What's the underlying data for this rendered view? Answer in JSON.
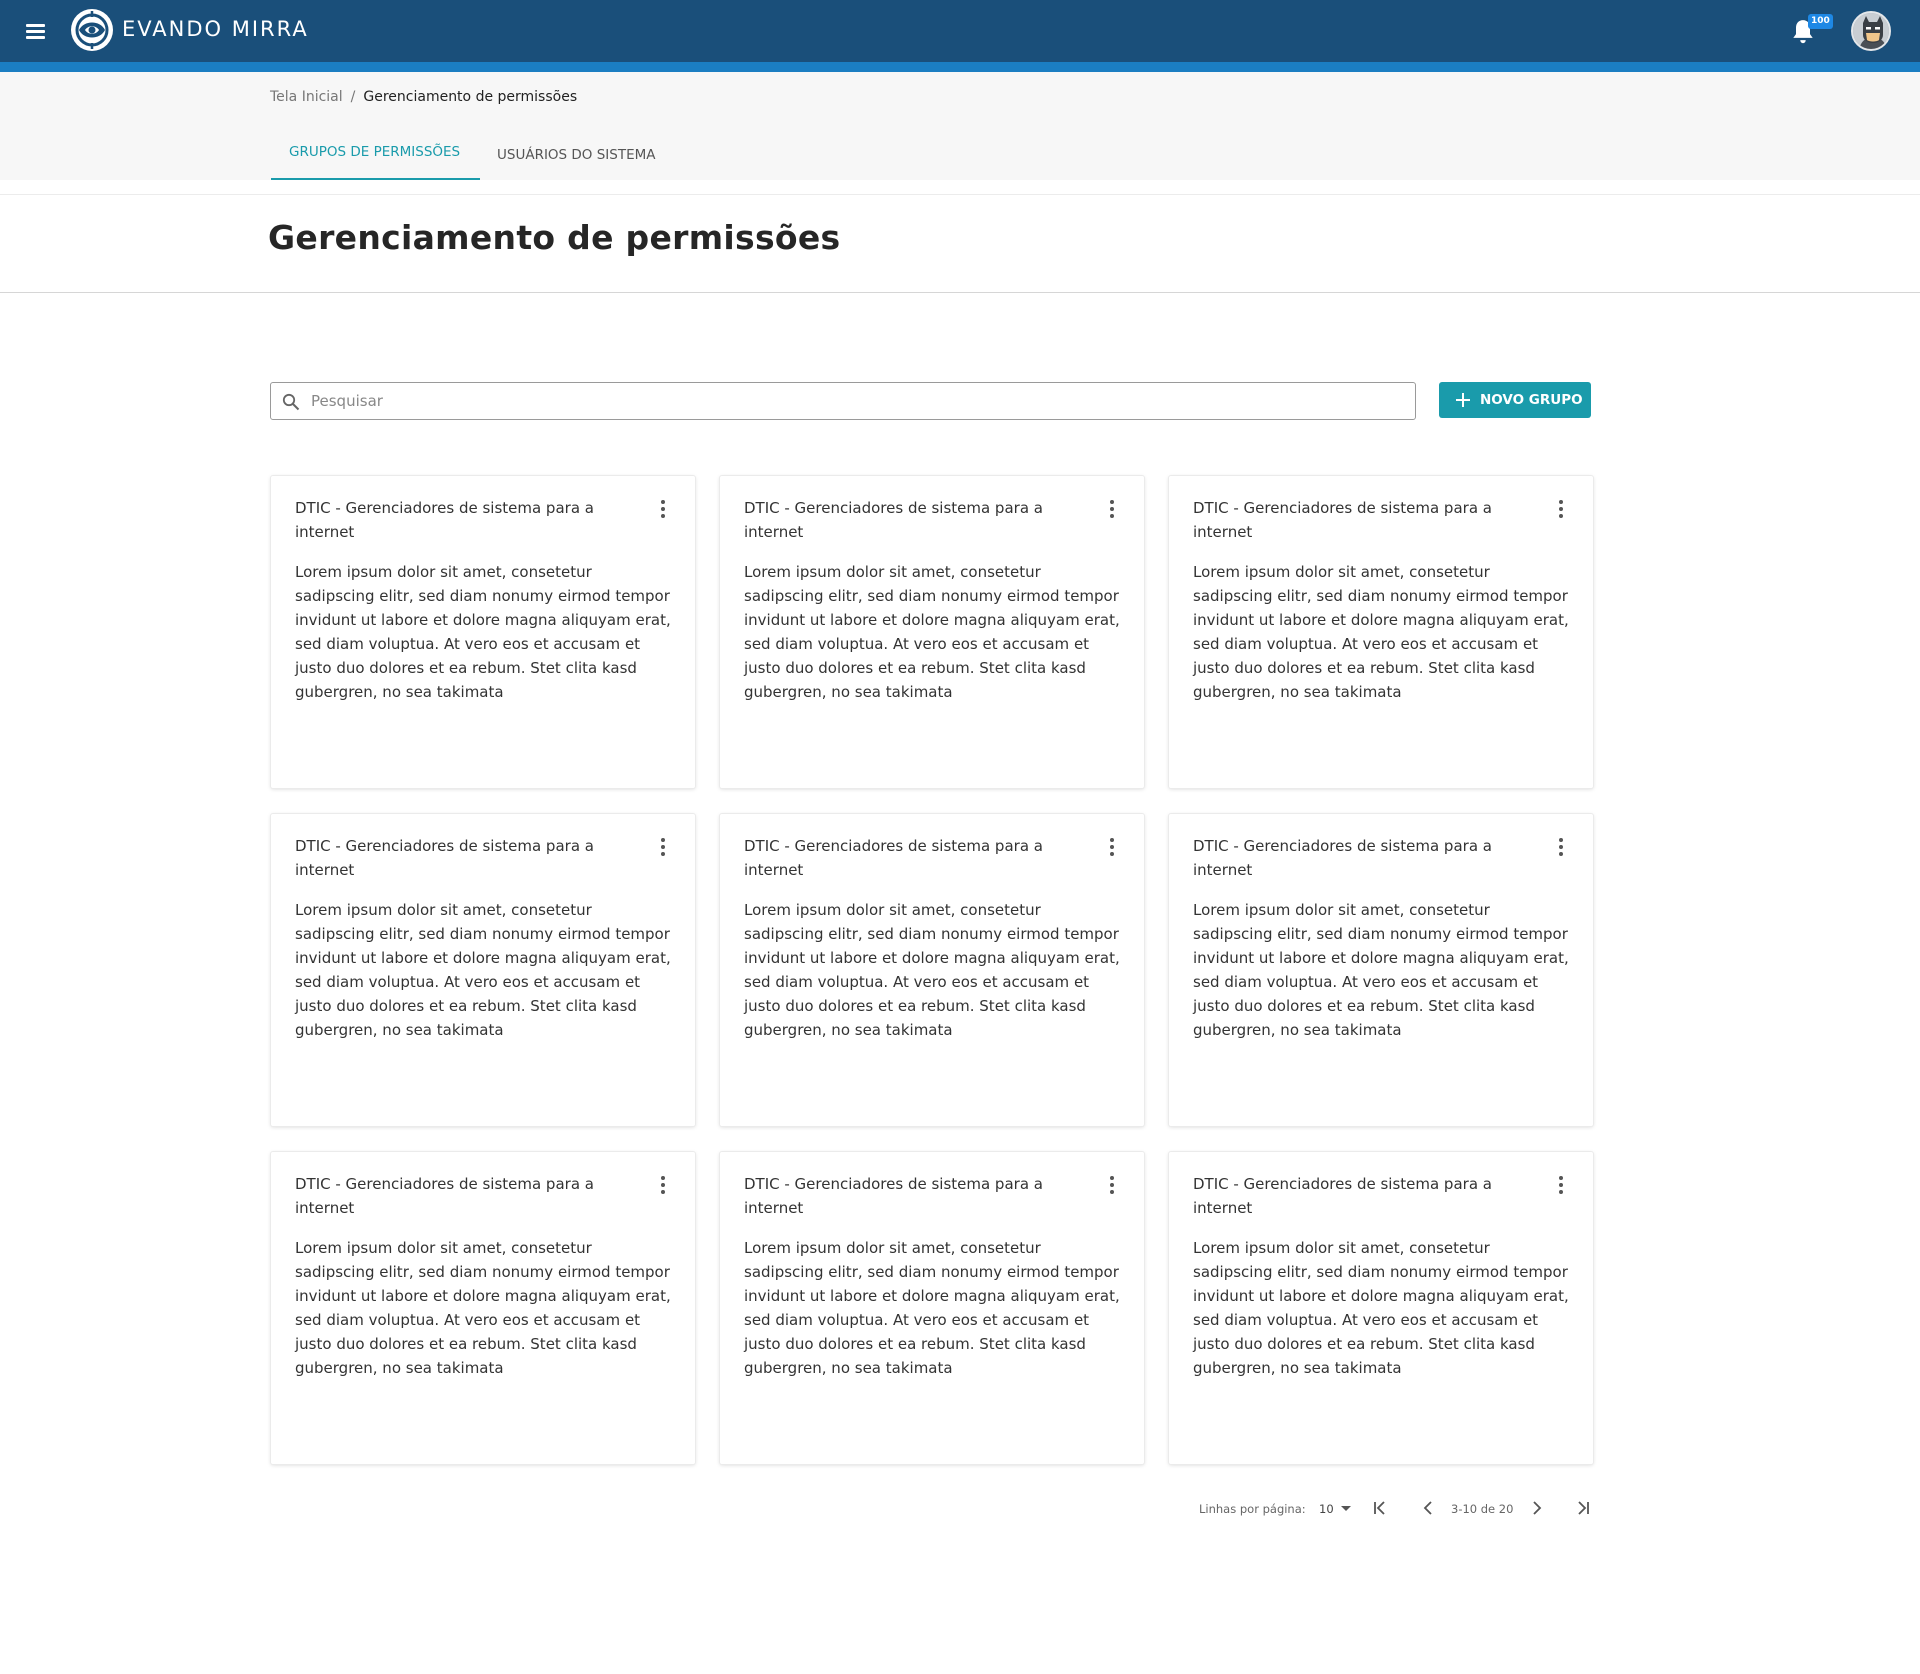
{
  "app": {
    "brand": "EVANDO MIRRA",
    "notifications_count": "100",
    "icons": {
      "menu": "menu-icon",
      "logo": "logo-icon",
      "notifications": "bell-icon",
      "avatar": "avatar"
    }
  },
  "breadcrumb": {
    "home": "Tela Inicial",
    "separator": "/",
    "current": "Gerenciamento de permissões"
  },
  "tabs": [
    {
      "label": "GRUPOS DE PERMISSÕES",
      "active": true
    },
    {
      "label": "USUÁRIOS DO SISTEMA",
      "active": false
    }
  ],
  "page": {
    "title": "Gerenciamento de permissões"
  },
  "search": {
    "placeholder": "Pesquisar",
    "value": ""
  },
  "new_group_button": {
    "label": "NOVO GRUPO"
  },
  "cards": [
    {
      "title": "DTIC - Gerenciadores de sistema para a internet",
      "description": "Lorem ipsum dolor sit amet, consetetur sadipscing elitr, sed diam nonumy eirmod tempor invidunt ut labore et dolore magna aliquyam erat, sed diam voluptua. At vero eos et accusam et justo duo dolores et ea rebum. Stet clita kasd gubergren, no sea takimata"
    },
    {
      "title": "DTIC - Gerenciadores de sistema para a internet",
      "description": "Lorem ipsum dolor sit amet, consetetur sadipscing elitr, sed diam nonumy eirmod tempor invidunt ut labore et dolore magna aliquyam erat, sed diam voluptua. At vero eos et accusam et justo duo dolores et ea rebum. Stet clita kasd gubergren, no sea takimata"
    },
    {
      "title": "DTIC - Gerenciadores de sistema para a internet",
      "description": "Lorem ipsum dolor sit amet, consetetur sadipscing elitr, sed diam nonumy eirmod tempor invidunt ut labore et dolore magna aliquyam erat, sed diam voluptua. At vero eos et accusam et justo duo dolores et ea rebum. Stet clita kasd gubergren, no sea takimata"
    },
    {
      "title": "DTIC - Gerenciadores de sistema para a internet",
      "description": "Lorem ipsum dolor sit amet, consetetur sadipscing elitr, sed diam nonumy eirmod tempor invidunt ut labore et dolore magna aliquyam erat, sed diam voluptua. At vero eos et accusam et justo duo dolores et ea rebum. Stet clita kasd gubergren, no sea takimata"
    },
    {
      "title": "DTIC - Gerenciadores de sistema para a internet",
      "description": "Lorem ipsum dolor sit amet, consetetur sadipscing elitr, sed diam nonumy eirmod tempor invidunt ut labore et dolore magna aliquyam erat, sed diam voluptua. At vero eos et accusam et justo duo dolores et ea rebum. Stet clita kasd gubergren, no sea takimata"
    },
    {
      "title": "DTIC - Gerenciadores de sistema para a internet",
      "description": "Lorem ipsum dolor sit amet, consetetur sadipscing elitr, sed diam nonumy eirmod tempor invidunt ut labore et dolore magna aliquyam erat, sed diam voluptua. At vero eos et accusam et justo duo dolores et ea rebum. Stet clita kasd gubergren, no sea takimata"
    },
    {
      "title": "DTIC - Gerenciadores de sistema para a internet",
      "description": "Lorem ipsum dolor sit amet, consetetur sadipscing elitr, sed diam nonumy eirmod tempor invidunt ut labore et dolore magna aliquyam erat, sed diam voluptua. At vero eos et accusam et justo duo dolores et ea rebum. Stet clita kasd gubergren, no sea takimata"
    },
    {
      "title": "DTIC - Gerenciadores de sistema para a internet",
      "description": "Lorem ipsum dolor sit amet, consetetur sadipscing elitr, sed diam nonumy eirmod tempor invidunt ut labore et dolore magna aliquyam erat, sed diam voluptua. At vero eos et accusam et justo duo dolores et ea rebum. Stet clita kasd gubergren, no sea takimata"
    },
    {
      "title": "DTIC - Gerenciadores de sistema para a internet",
      "description": "Lorem ipsum dolor sit amet, consetetur sadipscing elitr, sed diam nonumy eirmod tempor invidunt ut labore et dolore magna aliquyam erat, sed diam voluptua. At vero eos et accusam et justo duo dolores et ea rebum. Stet clita kasd gubergren, no sea takimata"
    }
  ],
  "pagination": {
    "rows_label": "Linhas por página:",
    "rows_per_page": "10",
    "range": "3-10 de 20"
  },
  "colors": {
    "appbar": "#1a4f7a",
    "appbar_accent": "#1b7ec2",
    "primary": "#1a9bab",
    "badge": "#1e88e5"
  }
}
